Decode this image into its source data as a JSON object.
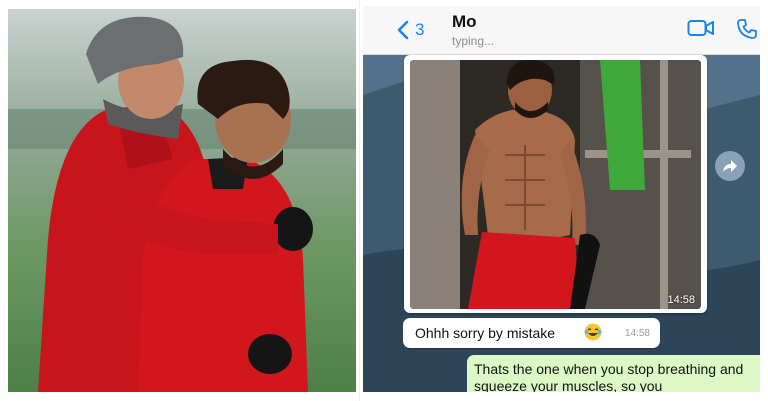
{
  "chat": {
    "back_count": "3",
    "contact_name": "Mo",
    "status": "typing...",
    "image_time": "14:58",
    "incoming_message": {
      "text": "Ohhh sorry by mistake",
      "emoji": "laughing-tears-emoji",
      "time": "14:58"
    },
    "outgoing_message": {
      "text": "Thats the one when you stop breathing and squeeze your muscles, so you"
    }
  },
  "colors": {
    "accent_blue": "#1a86e8",
    "outgoing_bubble": "#dcf8c6",
    "incoming_bubble": "#ffffff",
    "kit_red": "#d2161e"
  },
  "icons": {
    "back": "chevron-left-icon",
    "video": "video-camera-icon",
    "call": "phone-icon",
    "share": "forward-arrow-icon"
  }
}
